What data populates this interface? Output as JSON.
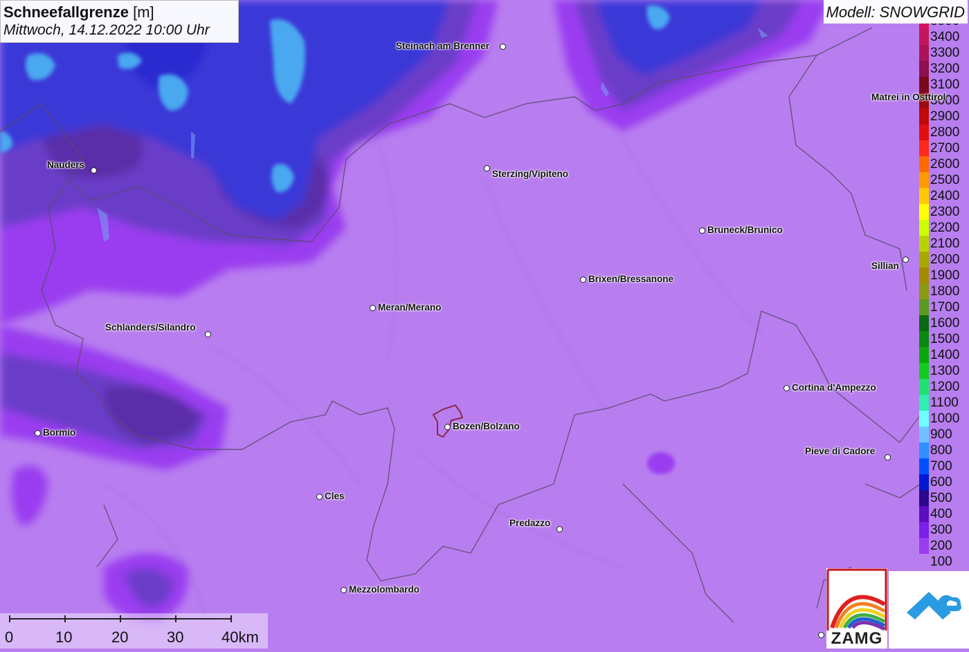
{
  "title": {
    "variable": "Schneefallgrenze",
    "unit": "[m]",
    "datetime": "Mittwoch, 14.12.2022 10:00 Uhr"
  },
  "model": "Modell: SNOWGRID",
  "legend": [
    {
      "label": "3500",
      "color": "#d4145a"
    },
    {
      "label": "3400",
      "color": "#c2185b"
    },
    {
      "label": "3300",
      "color": "#ad1457"
    },
    {
      "label": "3200",
      "color": "#8e1050"
    },
    {
      "label": "3100",
      "color": "#7a0a1a"
    },
    {
      "label": "3000",
      "color": "#9b0d0d"
    },
    {
      "label": "2900",
      "color": "#c00a0a"
    },
    {
      "label": "2800",
      "color": "#e01010"
    },
    {
      "label": "2700",
      "color": "#ff2a1a"
    },
    {
      "label": "2600",
      "color": "#ff6a00"
    },
    {
      "label": "2500",
      "color": "#ff9a00"
    },
    {
      "label": "2400",
      "color": "#ffc800"
    },
    {
      "label": "2300",
      "color": "#ffff00"
    },
    {
      "label": "2200",
      "color": "#ccff00"
    },
    {
      "label": "2100",
      "color": "#b8d400"
    },
    {
      "label": "2000",
      "color": "#a8a800"
    },
    {
      "label": "1900",
      "color": "#a08a00"
    },
    {
      "label": "1800",
      "color": "#8a9a10"
    },
    {
      "label": "1700",
      "color": "#5a9a20"
    },
    {
      "label": "1600",
      "color": "#0a6a10"
    },
    {
      "label": "1500",
      "color": "#0a8a10"
    },
    {
      "label": "1400",
      "color": "#0aa80a"
    },
    {
      "label": "1300",
      "color": "#10cc20"
    },
    {
      "label": "1200",
      "color": "#20e070"
    },
    {
      "label": "1100",
      "color": "#30f0b0"
    },
    {
      "label": "1000",
      "color": "#70ffff"
    },
    {
      "label": "900",
      "color": "#70c0ff"
    },
    {
      "label": "800",
      "color": "#3090ff"
    },
    {
      "label": "700",
      "color": "#0050ff"
    },
    {
      "label": "600",
      "color": "#0018d0"
    },
    {
      "label": "500",
      "color": "#2a0a8a"
    },
    {
      "label": "400",
      "color": "#5a10c0"
    },
    {
      "label": "300",
      "color": "#7a20e8"
    },
    {
      "label": "200",
      "color": "#9a3cf0"
    },
    {
      "label": "100",
      "color": "#b87ef0"
    }
  ],
  "cities": [
    {
      "name": "Steinach am Brenner",
      "icon": "city-dot-icon"
    },
    {
      "name": "Nauders",
      "icon": "city-dot-icon"
    },
    {
      "name": "Sterzing/Vipiteno",
      "icon": "city-dot-icon"
    },
    {
      "name": "Matrei in Osttirol",
      "icon": "city-dot-icon"
    },
    {
      "name": "Bruneck/Brunico",
      "icon": "city-dot-icon"
    },
    {
      "name": "Sillian",
      "icon": "city-dot-icon"
    },
    {
      "name": "Brixen/Bressanone",
      "icon": "city-dot-icon"
    },
    {
      "name": "Meran/Merano",
      "icon": "city-dot-icon"
    },
    {
      "name": "Schlanders/Silandro",
      "icon": "city-dot-icon"
    },
    {
      "name": "Cortina d'Ampezzo",
      "icon": "city-dot-icon"
    },
    {
      "name": "Bozen/Bolzano",
      "icon": "city-dot-icon"
    },
    {
      "name": "Bormio",
      "icon": "city-dot-icon"
    },
    {
      "name": "Pieve di Cadore",
      "icon": "city-dot-icon"
    },
    {
      "name": "Cles",
      "icon": "city-dot-icon"
    },
    {
      "name": "Predazzo",
      "icon": "city-dot-icon"
    },
    {
      "name": "Mezzolombardo",
      "icon": "city-dot-icon"
    }
  ],
  "scalebar": {
    "labels": [
      "0",
      "10",
      "20",
      "30",
      "40km"
    ]
  },
  "logos": {
    "zamg": "ZAMG",
    "geosphere_icon": "geosphere-logo-icon"
  },
  "colors": {
    "base_snowline": "#b87ef0",
    "high_band": "#9a3cf0",
    "mid_band": "#5a2fa8",
    "low_band": "#2a3ad8",
    "lowest_band": "#4aa8f0"
  }
}
